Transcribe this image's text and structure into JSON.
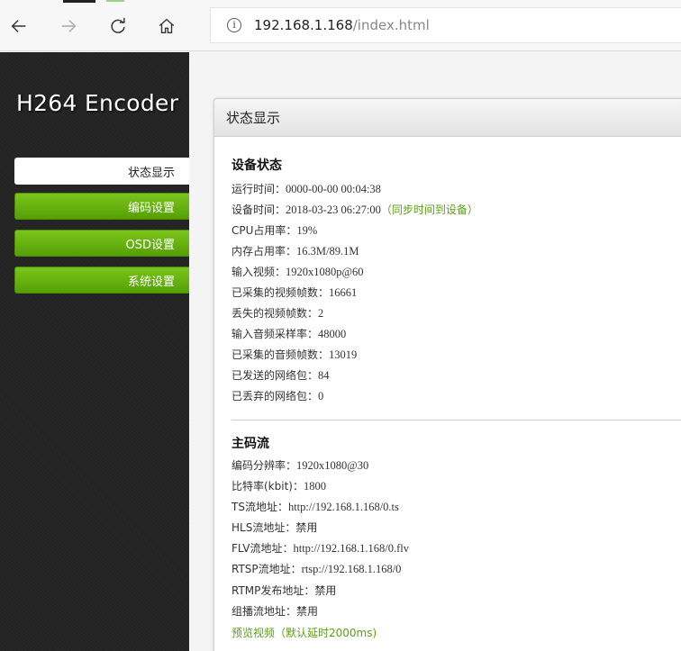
{
  "browser": {
    "url_host": "192.168.1.168",
    "url_path": "/index.html"
  },
  "sidebar": {
    "logo": "H264 Encoder",
    "items": [
      {
        "label": "状态显示",
        "active": true
      },
      {
        "label": "编码设置",
        "active": false
      },
      {
        "label": "OSD设置",
        "active": false
      },
      {
        "label": "系统设置",
        "active": false
      }
    ]
  },
  "panel": {
    "title": "状态显示",
    "device_status": {
      "title": "设备状态",
      "rows": [
        {
          "label": "运行时间：",
          "value": "0000-00-00 00:04:38"
        },
        {
          "label": "设备时间：",
          "value": "2018-03-23 06:27:00"
        },
        {
          "label": "CPU占用率：",
          "value": "19%"
        },
        {
          "label": "内存占用率：",
          "value": "16.3M/89.1M"
        },
        {
          "label": "输入视频：",
          "value": "1920x1080p@60"
        },
        {
          "label": "已采集的视频帧数：",
          "value": "16661"
        },
        {
          "label": "丢失的视频帧数：",
          "value": "2"
        },
        {
          "label": "输入音频采样率：",
          "value": "48000"
        },
        {
          "label": "已采集的音频帧数：",
          "value": "13019"
        },
        {
          "label": "已发送的网络包：",
          "value": "84"
        },
        {
          "label": "已丢弃的网络包：",
          "value": "0"
        }
      ],
      "sync_link": "（同步时间到设备）"
    },
    "main_stream": {
      "title": "主码流",
      "rows": [
        {
          "label": "编码分辨率：",
          "value": "1920x1080@30"
        },
        {
          "label": "比特率(kbit)：",
          "value": "1800"
        },
        {
          "label": "TS流地址：",
          "value": "http://192.168.1.168/0.ts"
        },
        {
          "label": "HLS流地址：",
          "value": "禁用"
        },
        {
          "label": "FLV流地址：",
          "value": "http://192.168.1.168/0.flv"
        },
        {
          "label": "RTSP流地址：",
          "value": "rtsp://192.168.1.168/0"
        },
        {
          "label": "RTMP发布地址：",
          "value": "禁用"
        },
        {
          "label": "组播流地址：",
          "value": "禁用"
        }
      ],
      "preview_link": "预览视频（默认延时2000ms)"
    }
  },
  "colors": {
    "accent_green": "#5aa015",
    "menu_green": "#6ab511",
    "sidebar_bg": "#232323"
  }
}
